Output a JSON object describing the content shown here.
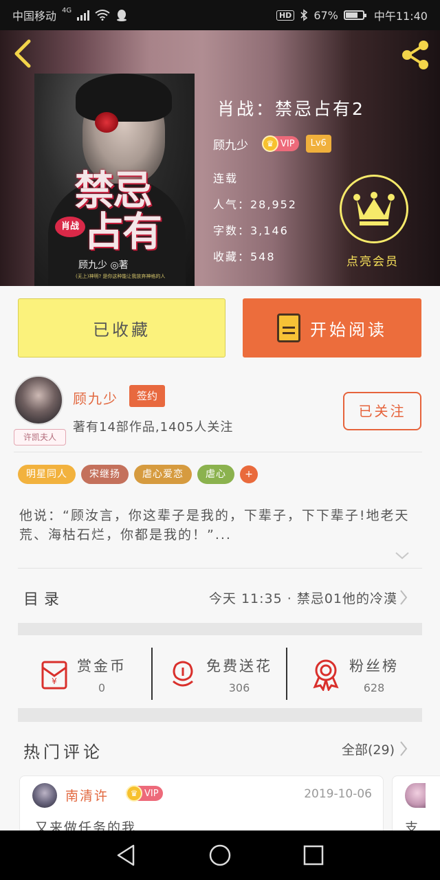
{
  "status_bar": {
    "carrier": "中国移动",
    "network": "4G",
    "battery": "67%",
    "battery_level": 0.67,
    "time": "中午11:40"
  },
  "book": {
    "title": "肖战：禁忌占有2",
    "author": "顾九少",
    "vip_label": "VIP",
    "level": "Lv6",
    "status": "连载",
    "popularity": "人气：28,952",
    "word_count": "字数：3,146",
    "favorites": "收藏：548",
    "cover": {
      "title_line1": "禁忌",
      "title_line2": "占有",
      "heart_text": "肖战",
      "author_line": "顾九少 ◎著",
      "tiny_line": "(无上)神明? 是你这种能让我放弃神格的人"
    }
  },
  "member": {
    "label": "点亮会员"
  },
  "actions": {
    "favorite_label": "已收藏",
    "read_label": "开始阅读"
  },
  "author_card": {
    "name": "顾九少",
    "sign_badge": "签约",
    "stats": "著有14部作品,1405人关注",
    "follow_label": "已关注",
    "avatar_tag": "许凯夫人"
  },
  "tags": [
    {
      "label": "明星同人",
      "color": "#f2b23e"
    },
    {
      "label": "宋继扬",
      "color": "#c4715c"
    },
    {
      "label": "虐心爱恋",
      "color": "#d69b3f"
    },
    {
      "label": "虐心",
      "color": "#8bb24e"
    }
  ],
  "tag_more": "+",
  "synopsis": "他说：“顾汝言，你这辈子是我的，下辈子，下下辈子!地老天荒、海枯石烂，你都是我的！”...",
  "toc": {
    "label": "目录",
    "latest": "今天 11:35 · 禁忌01他的冷漠"
  },
  "stats": [
    {
      "label": "赏金币",
      "value": "0",
      "icon": "red-envelope-icon"
    },
    {
      "label": "免费送花",
      "value": "306",
      "icon": "flower-icon"
    },
    {
      "label": "粉丝榜",
      "value": "628",
      "icon": "medal-icon"
    }
  ],
  "comments": {
    "label": "热门评论",
    "all_label": "全部(29)",
    "items": [
      {
        "name": "南清许",
        "vip": "VIP",
        "date": "2019-10-06",
        "text": "又来做任务的我"
      },
      {
        "name": "",
        "vip": "",
        "date": "",
        "text": "支"
      }
    ]
  },
  "colors": {
    "accent_orange": "#ec6d3c",
    "fav_yellow": "#fbf27c",
    "crown_yellow": "#f6ea6a"
  }
}
